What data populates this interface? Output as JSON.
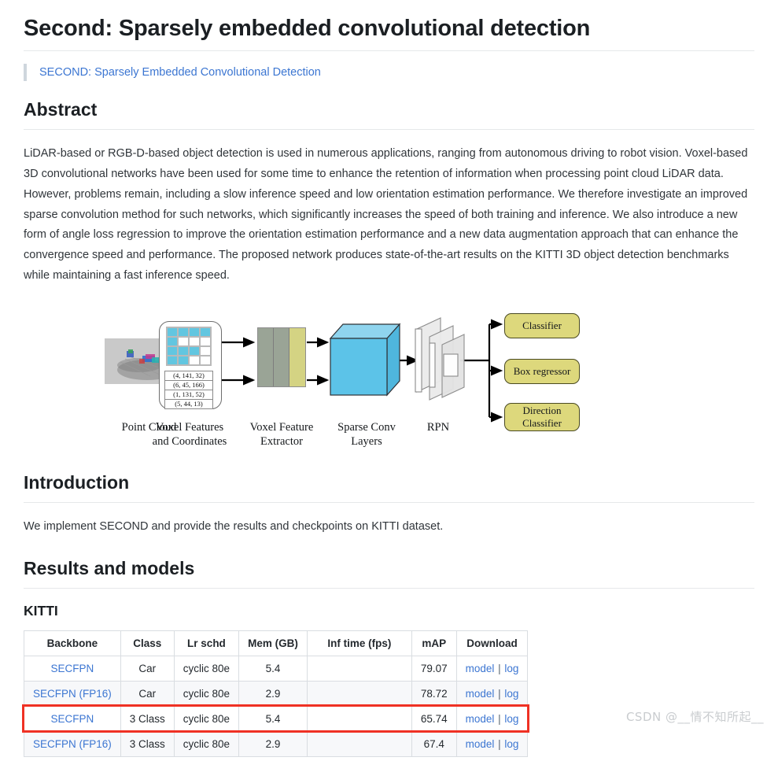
{
  "page": {
    "title": "Second: Sparsely embedded convolutional detection",
    "paper_link": "SECOND: Sparsely Embedded Convolutional Detection"
  },
  "sections": {
    "abstract": {
      "heading": "Abstract",
      "text": "LiDAR-based or RGB-D-based object detection is used in numerous applications, ranging from autonomous driving to robot vision. Voxel-based 3D convolutional networks have been used for some time to enhance the retention of information when processing point cloud LiDAR data. However, problems remain, including a slow inference speed and low orientation estimation performance. We therefore investigate an improved sparse convolution method for such networks, which significantly increases the speed of both training and inference. We also introduce a new form of angle loss regression to improve the orientation estimation performance and a new data augmentation approach that can enhance the convergence speed and performance. The proposed network produces state-of-the-art results on the KITTI 3D object detection benchmarks while maintaining a fast inference speed."
    },
    "introduction": {
      "heading": "Introduction",
      "text": "We implement SECOND and provide the results and checkpoints on KITTI dataset."
    },
    "results": {
      "heading": "Results and models",
      "subheading": "KITTI"
    }
  },
  "figure": {
    "name": "second-architecture-diagram",
    "captions": [
      {
        "lines": [
          "Point Cloud"
        ]
      },
      {
        "lines": [
          "Voxel Features",
          "and Coordinates"
        ]
      },
      {
        "lines": [
          "Voxel Feature",
          "Extractor"
        ]
      },
      {
        "lines": [
          "Sparse Conv",
          "Layers"
        ]
      },
      {
        "lines": [
          "RPN"
        ]
      }
    ],
    "voxel_coordinates": [
      "(4, 141, 32)",
      "(6, 45, 166)",
      "(1, 131, 52)",
      "(5, 44, 13)"
    ],
    "voxel_grid": [
      [
        1,
        1,
        1,
        1
      ],
      [
        1,
        0,
        0,
        0
      ],
      [
        1,
        1,
        1,
        0
      ],
      [
        1,
        1,
        0,
        0
      ]
    ],
    "output_heads": [
      "Classifier",
      "Box regressor",
      "Direction Classifier"
    ],
    "colors": {
      "voxel_cell": "#62c6e0",
      "cube": "#5cc3e8",
      "head_box": "#ddd87c",
      "vfe_gray": "#9aa496",
      "vfe_yellow": "#d4d383"
    }
  },
  "table": {
    "name": "kitti-results-table",
    "columns": [
      "Backbone",
      "Class",
      "Lr schd",
      "Mem (GB)",
      "Inf time (fps)",
      "mAP",
      "Download"
    ],
    "rows": [
      {
        "backbone": "SECFPN",
        "class": "Car",
        "lr_schd": "cyclic 80e",
        "mem": "5.4",
        "inf_time": "",
        "map": "79.07",
        "model": "model",
        "separator": "|",
        "log": "log",
        "highlighted": false
      },
      {
        "backbone": "SECFPN (FP16)",
        "class": "Car",
        "lr_schd": "cyclic 80e",
        "mem": "2.9",
        "inf_time": "",
        "map": "78.72",
        "model": "model",
        "separator": "|",
        "log": "log",
        "highlighted": false
      },
      {
        "backbone": "SECFPN",
        "class": "3 Class",
        "lr_schd": "cyclic 80e",
        "mem": "5.4",
        "inf_time": "",
        "map": "65.74",
        "model": "model",
        "separator": "|",
        "log": "log",
        "highlighted": true
      },
      {
        "backbone": "SECFPN (FP16)",
        "class": "3 Class",
        "lr_schd": "cyclic 80e",
        "mem": "2.9",
        "inf_time": "",
        "map": "67.4",
        "model": "model",
        "separator": "|",
        "log": "log",
        "highlighted": false
      }
    ],
    "highlight_color": "#ef3124"
  },
  "watermark": {
    "text": "CSDN @__情不知所起__"
  }
}
